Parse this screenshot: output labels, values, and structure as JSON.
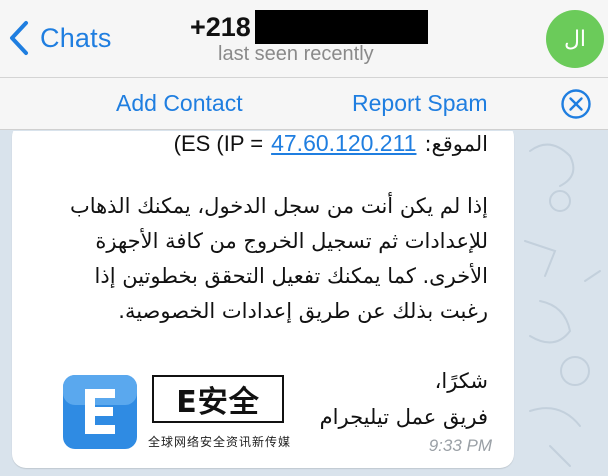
{
  "header": {
    "back_label": "Chats",
    "contact_number": "+218",
    "status": "last seen recently",
    "avatar_initials": "ال"
  },
  "action_bar": {
    "add_contact": "Add Contact",
    "report_spam": "Report Spam"
  },
  "message": {
    "location_label": "الموقع:",
    "ip_address": "47.60.120.211",
    "ip_prefix": "(ES (IP =",
    "paragraph_lines": [
      "إذا لم يكن أنت من سجل الدخول، يمكنك الذهاب",
      "للإعدادات ثم تسجيل الخروج من كافة الأجهزة",
      "الأخرى. كما يمكنك تفعيل التحقق بخطوتين إذا",
      "رغبت بذلك عن طريق إعدادات الخصوصية."
    ],
    "thanks": "شكرًا،",
    "signature": "فريق عمل تيليجرام",
    "time": "9:33 PM"
  },
  "watermark": {
    "brand": "E安全",
    "tagline": "全球网络安全资讯新传媒"
  },
  "colors": {
    "accent": "#1f7ee0",
    "avatar_bg": "#6bcb5a",
    "header_bg": "#f6f6f6",
    "chat_bg": "#d9e3ec"
  }
}
